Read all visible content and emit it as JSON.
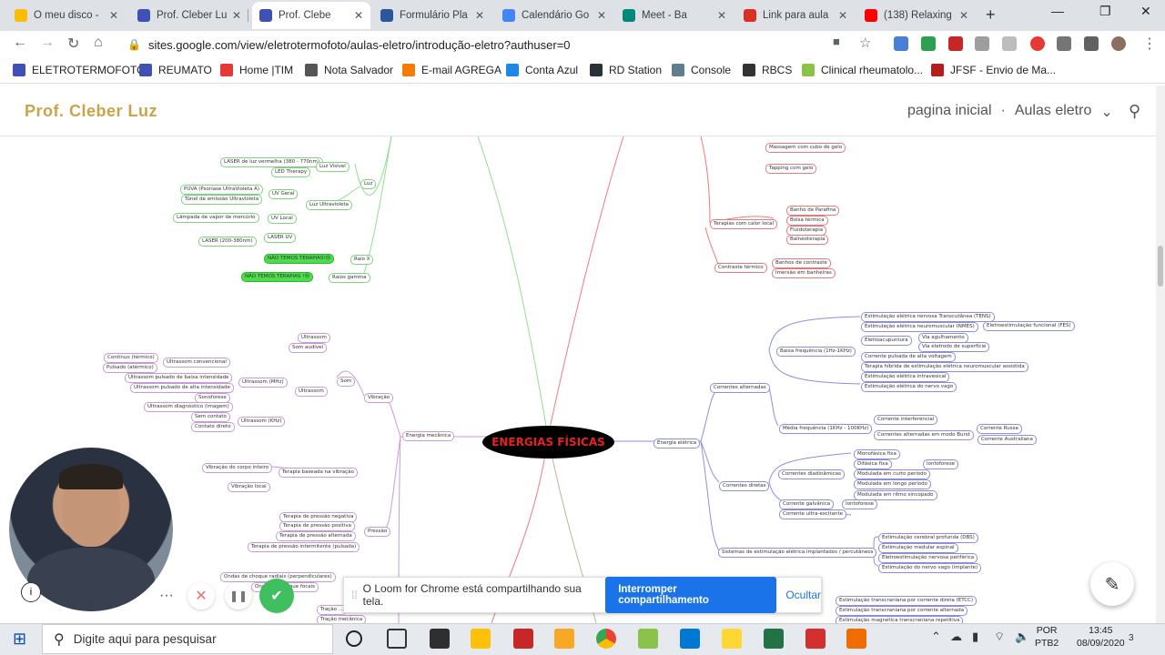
{
  "tabs": [
    {
      "label": "O meu disco - ",
      "icon": "google-drive-icon",
      "color": "#fbbc04"
    },
    {
      "label": "Prof. Cleber Lu",
      "icon": "google-sites-icon",
      "color": "#3f51b5"
    },
    {
      "label": "Prof. Clebe",
      "icon": "google-sites-icon",
      "color": "#3f51b5"
    },
    {
      "label": "Formulário Pla",
      "icon": "word-icon",
      "color": "#2b579a"
    },
    {
      "label": "Calendário Go",
      "icon": "calendar-icon",
      "color": "#4285f4"
    },
    {
      "label": "Meet - Ba",
      "icon": "meet-icon",
      "color": "#00897b"
    },
    {
      "label": "Link para aula",
      "icon": "gmail-icon",
      "color": "#d93025"
    },
    {
      "label": "(138) Relaxing",
      "icon": "youtube-icon",
      "color": "#ff0000"
    }
  ],
  "url": "sites.google.com/view/eletrotermofoto/aulas-eletro/introdução-eletro?authuser=0",
  "bookmarks": [
    {
      "label": "ELETROTERMOFOTO",
      "color": "#3f51b5"
    },
    {
      "label": "REUMATO",
      "color": "#3f51b5"
    },
    {
      "label": "Home |TIM",
      "color": "#e53935"
    },
    {
      "label": "Nota Salvador",
      "color": "#555"
    },
    {
      "label": "E-mail AGREGA",
      "color": "#f57c00"
    },
    {
      "label": "Conta Azul",
      "color": "#1e88e5"
    },
    {
      "label": "RD Station",
      "color": "#263238"
    },
    {
      "label": "Console",
      "color": "#607d8b"
    },
    {
      "label": "RBCS",
      "color": "#333"
    },
    {
      "label": "Clinical rheumatolo...",
      "color": "#8bc34a"
    },
    {
      "label": "JFSF - Envio de Ma...",
      "color": "#b71c1c"
    }
  ],
  "site": {
    "brand": "Prof. Cleber Luz",
    "nav_home": "pagina inicial",
    "nav_sep": "·",
    "nav_aulas": "Aulas eletro",
    "nav_chevron": "⌄",
    "search_symbol": "⚲"
  },
  "mindmap": {
    "center": "ENERGIAS FÍSICAS",
    "nodes": [
      {
        "t": "LASER de luz vermelha (380 - 770nm)",
        "c": "g"
      },
      {
        "t": "LED Therapy",
        "c": "g"
      },
      {
        "t": "Luz Visível",
        "c": "g"
      },
      {
        "t": "Luz",
        "c": "g"
      },
      {
        "t": "PUVA (Psoríase UltraVioleta A)",
        "c": "g"
      },
      {
        "t": "Túnel de emissão Ultravioleta",
        "c": "g"
      },
      {
        "t": "UV Geral",
        "c": "g"
      },
      {
        "t": "Luz Ultravioleta",
        "c": "g"
      },
      {
        "t": "Lâmpada de vapor de mercúrio",
        "c": "g"
      },
      {
        "t": "UV Local",
        "c": "g"
      },
      {
        "t": "LASER UV",
        "c": "g"
      },
      {
        "t": "LASER (200-380nm)",
        "c": "g"
      },
      {
        "t": "NÃO TEMOS TERAPIAS!😢",
        "c": "hg"
      },
      {
        "t": "Raio X",
        "c": "g"
      },
      {
        "t": "NÃO TEMOS TERAPIAS !😢",
        "c": "hg"
      },
      {
        "t": "Raios gamma",
        "c": "g"
      },
      {
        "t": "Massagem com cubo de gelo",
        "c": "r"
      },
      {
        "t": "Tapping com gelo",
        "c": "r"
      },
      {
        "t": "Banho de Parafina",
        "c": "r"
      },
      {
        "t": "Bolsa térmica",
        "c": "r"
      },
      {
        "t": "Terapias com calor local",
        "c": "r"
      },
      {
        "t": "Fluidoterapia",
        "c": "r"
      },
      {
        "t": "Balneoterapia",
        "c": "r"
      },
      {
        "t": "Contraste térmico",
        "c": "r"
      },
      {
        "t": "Banhos de contraste",
        "c": "r"
      },
      {
        "t": "Imersão em banheiras",
        "c": "r"
      },
      {
        "t": "Ultrassom",
        "c": "p"
      },
      {
        "t": "Som audível",
        "c": "p"
      },
      {
        "t": "Contínuo (térmico)",
        "c": "p"
      },
      {
        "t": "Ultrassom convencional",
        "c": "p"
      },
      {
        "t": "Pulsado (atérmico)",
        "c": "p"
      },
      {
        "t": "Ultrassom pulsado de baixa intensidade",
        "c": "p"
      },
      {
        "t": "Ultrassom (MHz)",
        "c": "p"
      },
      {
        "t": "Som",
        "c": "p"
      },
      {
        "t": "Ultrassom pulsado de alta intensidade",
        "c": "p"
      },
      {
        "t": "Ultrassom",
        "c": "p"
      },
      {
        "t": "Sonoforese",
        "c": "p"
      },
      {
        "t": "Vibração",
        "c": "p"
      },
      {
        "t": "Ultrassom diagnóstico (imagem)",
        "c": "p"
      },
      {
        "t": "Sem contato",
        "c": "p"
      },
      {
        "t": "Ultrassom (KHz)",
        "c": "p"
      },
      {
        "t": "Contato direto",
        "c": "p"
      },
      {
        "t": "Energia mecânica",
        "c": "p"
      },
      {
        "t": "Vibração do corpo inteiro",
        "c": "p"
      },
      {
        "t": "Terapia baseada na vibração",
        "c": "p"
      },
      {
        "t": "Vibração local",
        "c": "p"
      },
      {
        "t": "Terapia de pressão negativa",
        "c": "p"
      },
      {
        "t": "Terapia de pressão positiva",
        "c": "p"
      },
      {
        "t": "Pressão",
        "c": "p"
      },
      {
        "t": "Terapia de pressão alternada",
        "c": "p"
      },
      {
        "t": "Terapia de pressão intermitente (pulsada)",
        "c": "p"
      },
      {
        "t": "Ondas de choque radiais (perpendiculares)",
        "c": "p"
      },
      {
        "t": "Ondas de choque focais",
        "c": "p"
      },
      {
        "t": "Tração ...",
        "c": "p"
      },
      {
        "t": "Tração mecânica",
        "c": "p"
      },
      {
        "t": "Estimulação elétrica nervosa Transcutânea (TENS)",
        "c": "b"
      },
      {
        "t": "Estimulação elétrica neuromuscular (NMES)",
        "c": "b"
      },
      {
        "t": "Eletroestimulação funcional (FES)",
        "c": "b"
      },
      {
        "t": "Eletroacupuntura",
        "c": "b"
      },
      {
        "t": "Via agulhamento",
        "c": "b"
      },
      {
        "t": "Baixa frequência (1Hz-1KHz)",
        "c": "b"
      },
      {
        "t": "Via eletrodo de superfície",
        "c": "b"
      },
      {
        "t": "Corrente pulsada de alta voltagem",
        "c": "b"
      },
      {
        "t": "Terapia híbrida de estimulação elétrica neuromuscular assistida",
        "c": "b"
      },
      {
        "t": "Correntes alternadas",
        "c": "b"
      },
      {
        "t": "Estimulação elétrica intravesical",
        "c": "b"
      },
      {
        "t": "Estimulação elétrica do nervo vago",
        "c": "b"
      },
      {
        "t": "Corrente interferencial",
        "c": "b"
      },
      {
        "t": "Média frequência (1KHz - 100KHz)",
        "c": "b"
      },
      {
        "t": "Corrente Russa",
        "c": "b"
      },
      {
        "t": "Correntes alternadas em modo Burst",
        "c": "b"
      },
      {
        "t": "Corrente Australiana",
        "c": "b"
      },
      {
        "t": "Energia elétrica",
        "c": "b"
      },
      {
        "t": "Monofásica fixa",
        "c": "b"
      },
      {
        "t": "Difásica fixa",
        "c": "b"
      },
      {
        "t": "Iontoforese",
        "c": "b"
      },
      {
        "t": "Correntes diadinâmicas",
        "c": "b"
      },
      {
        "t": "Modulada em curto período",
        "c": "b"
      },
      {
        "t": "Modulada em longo período",
        "c": "b"
      },
      {
        "t": "Correntes diretas",
        "c": "b"
      },
      {
        "t": "Modulada em ritmo sincopado",
        "c": "b"
      },
      {
        "t": "Corrente galvânica",
        "c": "b"
      },
      {
        "t": "Iontoforese",
        "c": "b"
      },
      {
        "t": "Corrente ultra-excitante",
        "c": "b"
      },
      {
        "t": "Estimulação cerebral profunda (DBS)",
        "c": "b"
      },
      {
        "t": "Estimulação medular espinal",
        "c": "b"
      },
      {
        "t": "Sistemas de estimulação elétrica implantados / percutâneos",
        "c": "b"
      },
      {
        "t": "Eletroestimulação nervosa periférica",
        "c": "b"
      },
      {
        "t": "Estimulação do nervo vago (implante)",
        "c": "b"
      },
      {
        "t": "Estimulação transcraniana por corrente direta (ETCC)",
        "c": "b"
      },
      {
        "t": "Estimulação transcraniana por corrente alternada",
        "c": "b"
      },
      {
        "t": "Estimulação magnética transcraniana repetitiva",
        "c": "b"
      }
    ]
  },
  "loom": {
    "handle": "⁞⁞",
    "message": "O Loom for Chrome está compartilhando sua tela.",
    "stop_button": "Interromper compartilhamento",
    "hide_link": "Ocultar"
  },
  "loom_controls": {
    "more": "···",
    "cancel": "✕",
    "pause": "❚❚",
    "done": "✔"
  },
  "fab_symbol": "✎",
  "taskbar": {
    "search_placeholder": "Digite aqui para pesquisar",
    "lang_top": "POR",
    "lang_bottom": "PTB2",
    "time": "13:45",
    "date": "08/09/2020",
    "notifications": "3"
  },
  "colors": {
    "brand": "#c9a54a",
    "loom_blue": "#1a73e8",
    "center_text": "#e82020"
  }
}
